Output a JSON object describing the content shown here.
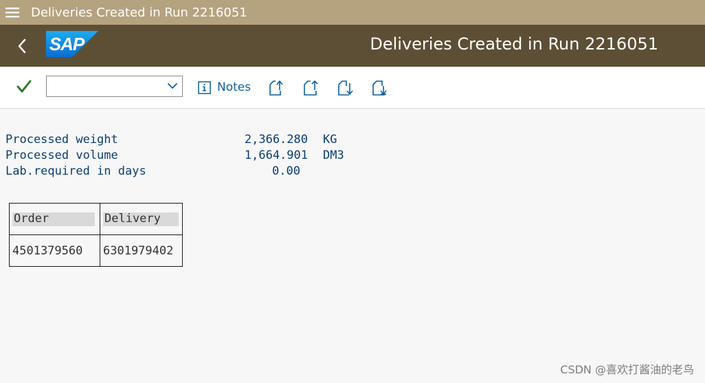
{
  "titlebar": {
    "title": "Deliveries Created in Run 2216051",
    "menu_icon": "hamburger-menu-icon"
  },
  "shellbar": {
    "logo_text": "SAP",
    "title": "Deliveries Created in Run 2216051",
    "back_icon": "chevron-left-icon"
  },
  "toolbar": {
    "dropdown_value": "",
    "notes_label": "Notes",
    "icons": [
      "checkmark-icon",
      "info-icon",
      "export-up-icon",
      "export-up-alt-icon",
      "import-down-icon",
      "import-down-alt-icon"
    ]
  },
  "summary": [
    {
      "label": "Processed weight",
      "value": "2,366.280",
      "unit": "KG"
    },
    {
      "label": "Processed volume",
      "value": "1,664.901",
      "unit": "DM3"
    },
    {
      "label": "Lab.required in days",
      "value": "0.00",
      "unit": ""
    }
  ],
  "table": {
    "headers": [
      "Order",
      "Delivery"
    ],
    "rows": [
      [
        "4501379560",
        "6301979402"
      ]
    ]
  },
  "watermark": "CSDN @喜欢打酱油的老鸟",
  "colors": {
    "titlebar_bg": "#b5a27f",
    "shellbar_bg": "#5d4f35",
    "accent_blue": "#0a5e9e",
    "check_green": "#2b7d2b"
  }
}
